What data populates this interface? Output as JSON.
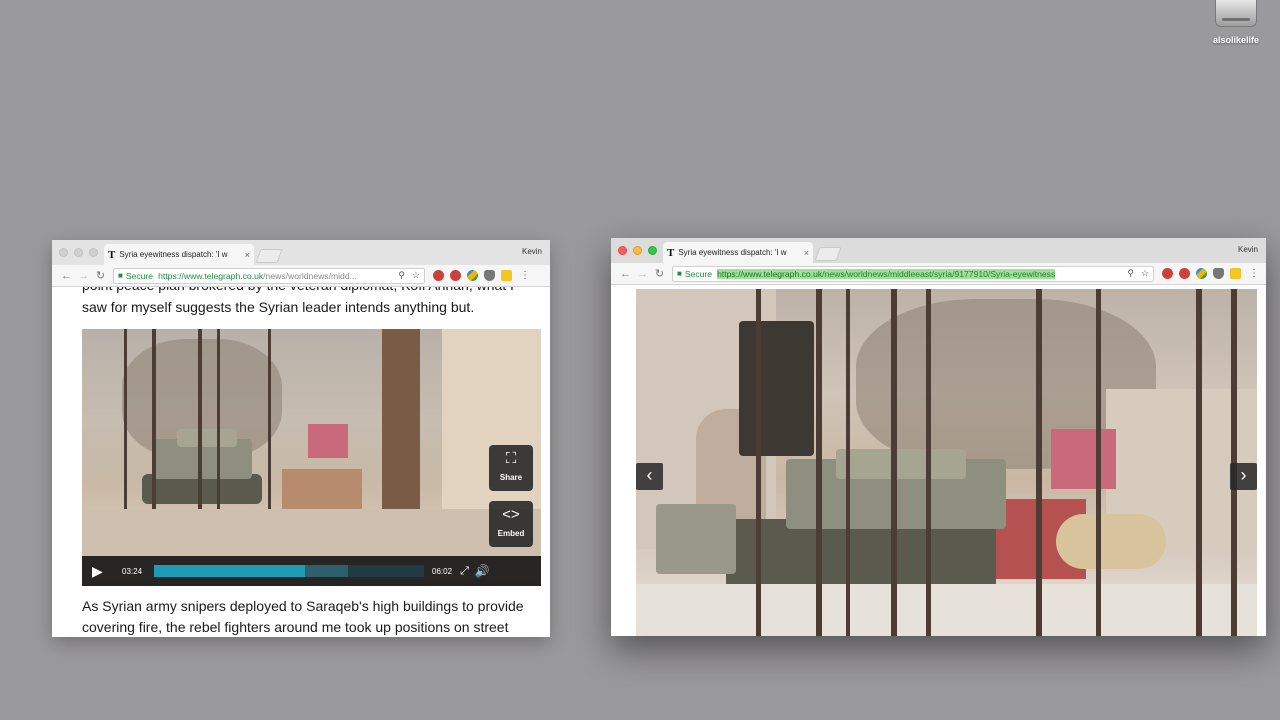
{
  "desktop": {
    "icon_label": "alsolikelife",
    "icon_name": "hard-drive-icon"
  },
  "window_left": {
    "tab_title": "Syria eyewitness dispatch: 'I w",
    "profile": "Kevin",
    "secure_label": "Secure",
    "url_host": "https://www.telegraph.co.uk",
    "url_path": "/news/worldnews/midd...",
    "article_text_cut": "point peace plan brokered by the veteran diplomat, Kofi Annan, what I",
    "article_text_top": "saw for myself suggests the Syrian leader intends anything but.",
    "article_text_bottom": "As Syrian army snipers deployed to Saraqeb's high buildings to provide covering fire, the rebel fighters around me took up positions on street",
    "video": {
      "share_label": "Share",
      "embed_label": "Embed",
      "current_time": "03:24",
      "duration": "06:02",
      "progress_fraction": 0.56,
      "buffer_fraction": 0.72
    }
  },
  "window_right": {
    "tab_title": "Syria eyewitness dispatch: 'I w",
    "profile": "Kevin",
    "secure_label": "Secure",
    "url_host": "https://www.telegraph.co.uk",
    "url_path": "/news/worldnews/middleeast/syria/9177910/Syria-eyewitness"
  },
  "glyphs": {
    "back": "←",
    "forward": "→",
    "reload": "↻",
    "lock": "🔒",
    "zoom": "⚲",
    "star": "☆",
    "close": "×",
    "kebab": "⋮",
    "favicon": "T",
    "play": "▶",
    "share": "⛶",
    "embed": "<>",
    "fullscreen": "⤢",
    "volume": "🔊",
    "prev": "‹",
    "next": "›"
  },
  "colors": {
    "desktop": "#9a999b",
    "secure_green": "#1e8e3e",
    "progress_fill": "#1f9ab5"
  }
}
